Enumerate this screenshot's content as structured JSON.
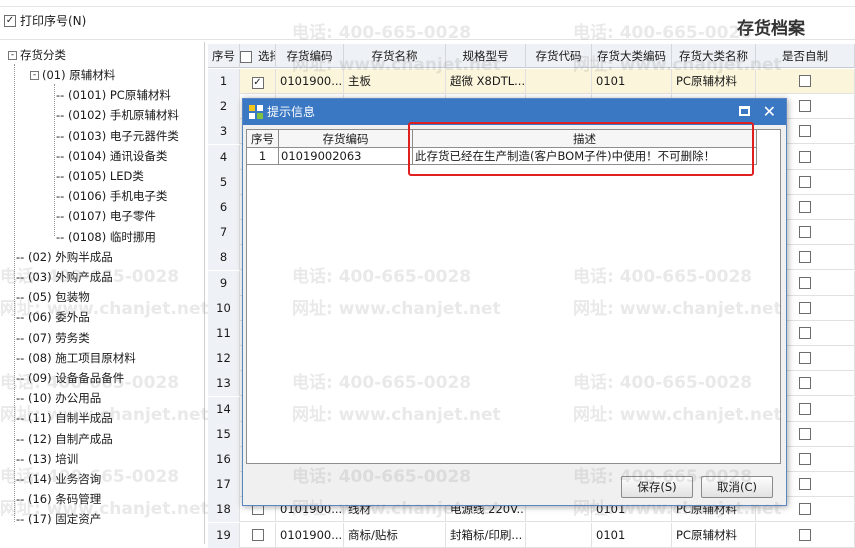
{
  "toolbar": {
    "print_seq_label": "打印序号(N)",
    "print_seq_checked": "✓"
  },
  "page_title": "存货档案",
  "tree": {
    "root": "存货分类",
    "items": [
      "(01) 原辅材料",
      "(0101) PC原辅材料",
      "(0102) 手机原辅材料",
      "(0103) 电子元器件类",
      "(0104) 通讯设备类",
      "(0105) LED类",
      "(0106) 手机电子类",
      "(0107) 电子零件",
      "(0108) 临时挪用",
      "(02) 外购半成品",
      "(03) 外购产成品",
      "(05) 包装物",
      "(06) 委外品",
      "(07) 劳务类",
      "(08) 施工项目原材料",
      "(09) 设备备品备件",
      "(10) 办公用品",
      "(11) 自制半成品",
      "(12) 自制产成品",
      "(13) 培训",
      "(14) 业务咨询",
      "(16) 条码管理",
      "(17) 固定资产"
    ]
  },
  "grid": {
    "headers": [
      "序号",
      "选择",
      "存货编码",
      "存货名称",
      "规格型号",
      "存货代码",
      "存货大类编码",
      "存货大类名称",
      "是否自制"
    ],
    "rows": [
      {
        "num": "1",
        "code": "0101900...",
        "name": "主板",
        "spec": "超微 X8DTL...",
        "cat_code": "0101",
        "cat_name": "PC原辅材料"
      },
      {
        "num": "2"
      },
      {
        "num": "3"
      },
      {
        "num": "4"
      },
      {
        "num": "5"
      },
      {
        "num": "6"
      },
      {
        "num": "7"
      },
      {
        "num": "8"
      },
      {
        "num": "9"
      },
      {
        "num": "10"
      },
      {
        "num": "11"
      },
      {
        "num": "12"
      },
      {
        "num": "13"
      },
      {
        "num": "14"
      },
      {
        "num": "15"
      },
      {
        "num": "16"
      },
      {
        "num": "17"
      },
      {
        "num": "18",
        "code": "0101900...",
        "name": "线材",
        "spec": "电源线 220V...",
        "cat_code": "0101",
        "cat_name": "PC原辅材料"
      },
      {
        "num": "19",
        "code": "0101900...",
        "name": "商标/贴标",
        "spec": "封箱标/印刷...",
        "cat_code": "0101",
        "cat_name": "PC原辅材料"
      }
    ]
  },
  "dialog": {
    "title": "提示信息",
    "headers": [
      "序号",
      "存货编码",
      "描述"
    ],
    "row": {
      "num": "1",
      "code": "01019002063",
      "desc": "此存货已经在生产制造(客户BOM子件)中使用！不可删除！"
    },
    "save_label": "保存(S)",
    "cancel_label": "取消(C)"
  },
  "watermark": {
    "phone": "电话: 400-665-0028",
    "site": "网址: www.chanjet.net"
  },
  "colors": {
    "title_bar": "#3a78c4",
    "highlight_row": "#fbf5dc",
    "annotation_box": "#e02020"
  }
}
